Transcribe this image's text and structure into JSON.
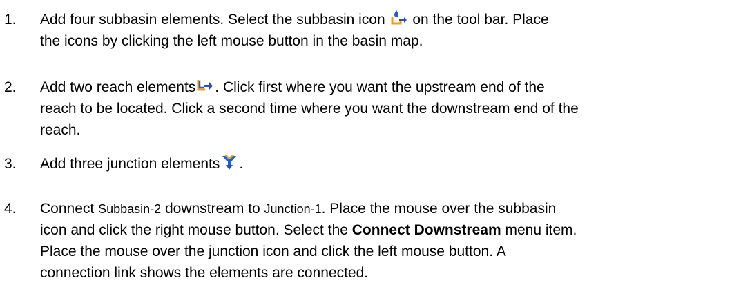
{
  "steps": [
    {
      "number": "1.",
      "line1_a": "Add four subbasin elements.  Select the subbasin icon",
      "line1_b": "on the tool bar.  Place",
      "line2": "the icons by clicking the left mouse button in the basin map.",
      "icon": "subbasin-icon"
    },
    {
      "number": "2.",
      "line1_a": "Add two reach elements",
      "line1_b": ".  Click first where you want the upstream end of the",
      "line2": "reach to be located.  Click a second time where you want the downstream end of the",
      "line3": "reach.",
      "icon": "reach-icon"
    },
    {
      "number": "3.",
      "line1_a": "Add three junction elements",
      "line1_b": ".",
      "icon": "junction-icon"
    },
    {
      "number": "4.",
      "line1_a": "Connect ",
      "line1_b": "Subbasin-2",
      "line1_c": " downstream to ",
      "line1_d": "Junction-1",
      "line1_e": ".  Place the mouse over the subbasin",
      "line2_a": "icon and click the right mouse button.  Select the ",
      "line2_bold": "Connect Downstream",
      "line2_c": " menu item.",
      "line3": "Place the mouse over the junction icon and click the left mouse button.  A",
      "line4": "connection link shows the elements are connected."
    }
  ],
  "colors": {
    "text": "#000000",
    "icon_blue": "#1f5fd6",
    "icon_orange": "#e8a020",
    "icon_arrow": "#2a4fb8"
  }
}
